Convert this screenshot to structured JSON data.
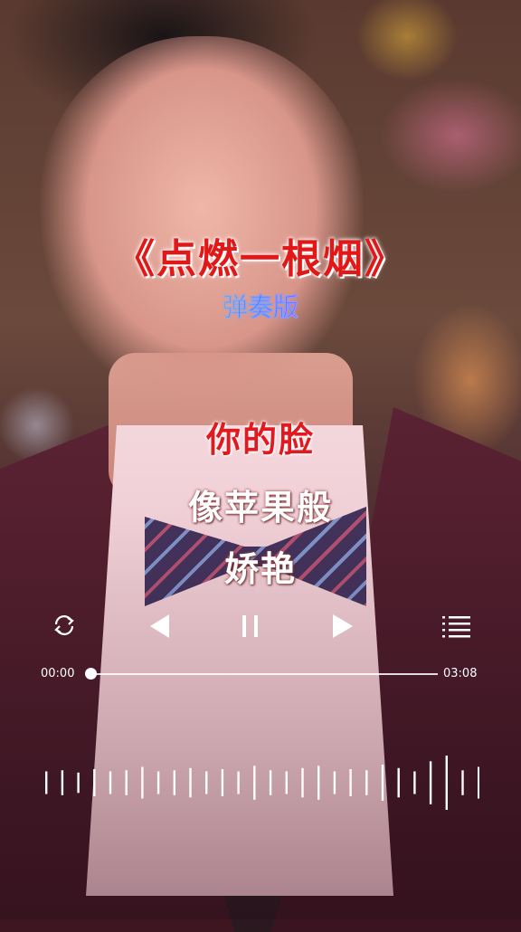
{
  "song": {
    "title": "《点燃一根烟》",
    "subtitle": "弹奏版"
  },
  "lyrics": {
    "current": "你的脸",
    "next": "像苹果般",
    "next2": "娇艳"
  },
  "player": {
    "current_time": "00:00",
    "total_time": "03:08",
    "progress": 0.0,
    "icons": {
      "repeat": "repeat-icon",
      "prev": "previous-icon",
      "pause": "pause-icon",
      "next": "next-icon",
      "playlist": "playlist-icon"
    }
  },
  "colors": {
    "title": "#e01818",
    "lyric_active": "#e11a20",
    "lyric_inactive": "#ffffff",
    "controls": "#ffffff"
  },
  "waveform": {
    "levels": [
      0.3,
      0.35,
      0.25,
      0.4,
      0.3,
      0.35,
      0.5,
      0.3,
      0.35,
      0.45,
      0.3,
      0.4,
      0.3,
      0.55,
      0.35,
      0.3,
      0.45,
      0.55,
      0.3,
      0.4,
      0.35,
      0.6,
      0.45,
      0.3,
      0.75,
      1.0,
      0.35,
      0.5
    ]
  }
}
